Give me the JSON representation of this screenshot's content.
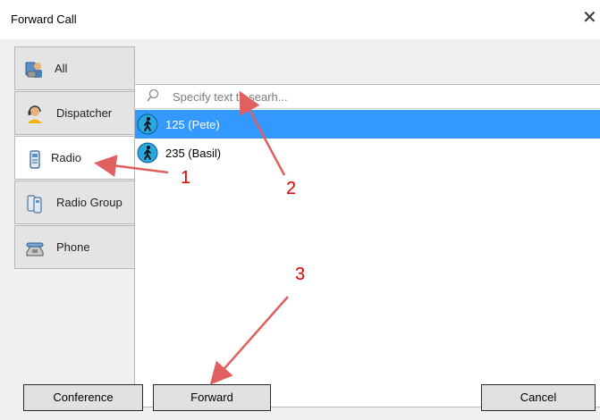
{
  "window": {
    "title": "Forward Call",
    "close_glyph": "✕"
  },
  "tabs": [
    {
      "label": "All",
      "icon": "all-contacts-icon",
      "active": false
    },
    {
      "label": "Dispatcher",
      "icon": "dispatcher-headset-icon",
      "active": false
    },
    {
      "label": "Radio",
      "icon": "radio-icon",
      "active": true
    },
    {
      "label": "Radio Group",
      "icon": "radio-group-icon",
      "active": false
    },
    {
      "label": "Phone",
      "icon": "phone-icon",
      "active": false
    }
  ],
  "search": {
    "placeholder": "Specify text to searh..."
  },
  "list": [
    {
      "label": "125 (Pete)",
      "icon": "walking-person-icon",
      "selected": true
    },
    {
      "label": "235 (Basil)",
      "icon": "walking-person-icon",
      "selected": false
    }
  ],
  "buttons": {
    "conference": "Conference",
    "forward": "Forward",
    "cancel": "Cancel"
  },
  "annotations": {
    "one": "1",
    "two": "2",
    "three": "3"
  },
  "colors": {
    "selection": "#3399ff",
    "annotation": "#e00000"
  }
}
